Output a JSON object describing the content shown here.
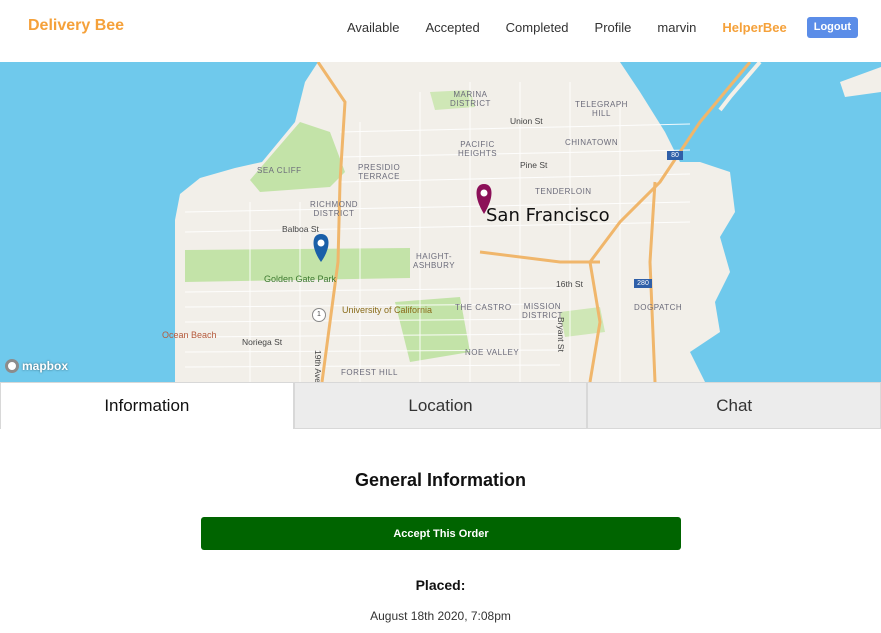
{
  "navbar": {
    "brand": "Delivery Bee",
    "links": [
      "Available",
      "Accepted",
      "Completed",
      "Profile",
      "marvin"
    ],
    "role_link": "HelperBee",
    "logout": "Logout"
  },
  "map": {
    "city": "San Francisco",
    "attribution": "mapbox",
    "labels": {
      "marina": "MARINA\nDISTRICT",
      "telegraph": "TELEGRAPH\nHILL",
      "union": "Union St",
      "pacific": "PACIFIC\nHEIGHTS",
      "chinatown": "CHINATOWN",
      "seacliff": "SEA CLIFF",
      "presidio": "PRESIDIO\nTERRACE",
      "pine": "Pine St",
      "tenderloin": "TENDERLOIN",
      "richmond": "RICHMOND\nDISTRICT",
      "balboa": "Balboa St",
      "haight": "HAIGHT-\nASHBURY",
      "ggpark": "Golden Gate Park",
      "sixteenth": "16th St",
      "castro": "THE CASTRO",
      "mission": "MISSION\nDISTRICT",
      "bryant": "Bryant St",
      "ucsf": "University of California",
      "dogpatch": "DOGPATCH",
      "ocean": "Ocean Beach",
      "noriega": "Noriega St",
      "noe": "NOE VALLEY",
      "forest": "FOREST HILL",
      "nineteenth": "19th Ave",
      "route1": "1",
      "i80": "80",
      "i280": "280"
    },
    "pins": [
      {
        "name": "pickup",
        "color": "#1a5fa8"
      },
      {
        "name": "dropoff",
        "color": "#8c1058"
      }
    ],
    "colors": {
      "water": "#6fc9ec",
      "land": "#f2efe9",
      "park": "#c3e3a8",
      "highway": "#f0b66b"
    }
  },
  "tabs": [
    {
      "label": "Information",
      "active": true
    },
    {
      "label": "Location",
      "active": false
    },
    {
      "label": "Chat",
      "active": false
    }
  ],
  "info": {
    "title": "General Information",
    "accept_button": "Accept This Order",
    "placed_label": "Placed:",
    "placed_value": "August 18th 2020, 7:08pm"
  },
  "colors": {
    "brand": "#f5a13a",
    "logout": "#5b8de8",
    "accept": "#006400"
  }
}
